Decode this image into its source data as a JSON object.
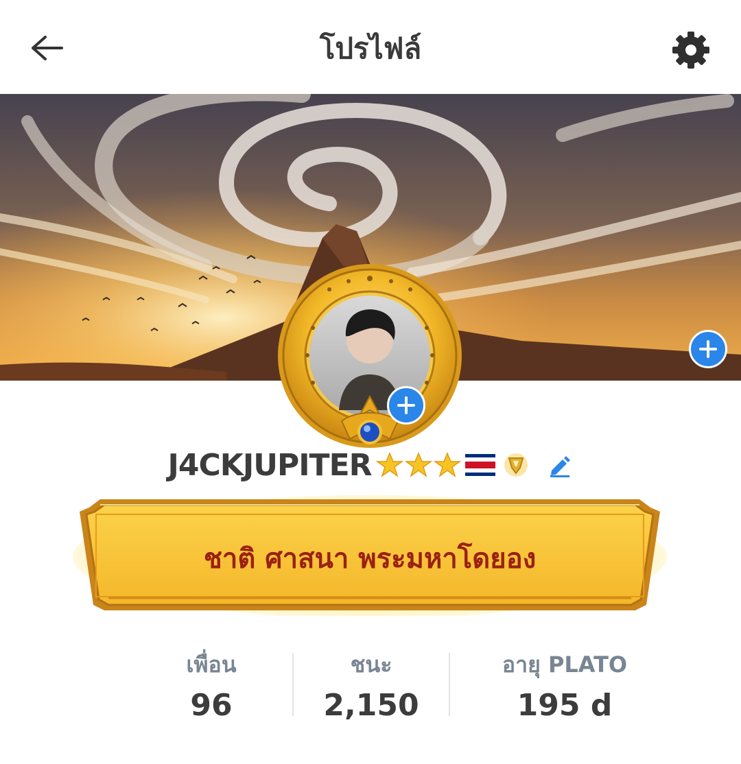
{
  "header": {
    "title": "โปรไฟล์",
    "back_icon": "arrow-left-icon",
    "settings_icon": "gear-icon"
  },
  "banner": {
    "description_icon": "swirl-cloud-banner",
    "add_icon": "plus-icon"
  },
  "profile": {
    "username": "J4CKJUPITER",
    "stars": 3,
    "country_flag": "costa-rica-flag-icon",
    "rank_badge": "shield-badge-icon",
    "edit_icon": "pencil-icon",
    "avatar_add_icon": "plus-icon"
  },
  "motto": {
    "text": "ชาติ ศาสนา พระมหาโดยอง"
  },
  "stats": [
    {
      "label": "เพื่อน",
      "value": "96"
    },
    {
      "label": "ชนะ",
      "value": "2,150"
    },
    {
      "label": "อายุ PLATO",
      "value": "195 d"
    }
  ],
  "colors": {
    "accent_blue": "#2a86e8",
    "gold": "#f5c233",
    "motto_text": "#9b2014",
    "stat_label": "#7a8593"
  }
}
